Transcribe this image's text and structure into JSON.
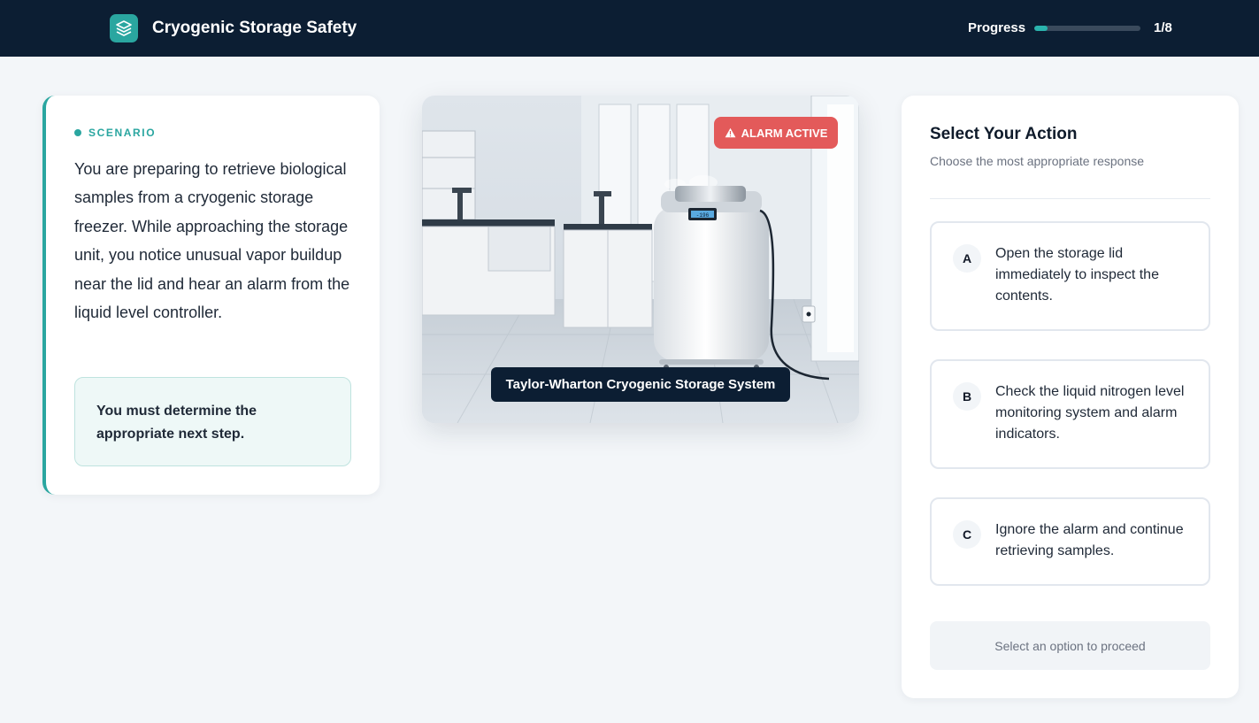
{
  "header": {
    "title": "Cryogenic Storage Safety",
    "progress_label": "Progress",
    "progress_count": "1/8",
    "progress_fraction": 0.125
  },
  "scenario": {
    "tag": "SCENARIO",
    "text": "You are preparing to retrieve biological samples from a cryogenic storage freezer. While approaching the storage unit, you notice unusual vapor buildup near the lid and hear an alarm from the liquid level controller.",
    "note": "You must determine the appropriate next step."
  },
  "scene": {
    "alarm_label": "ALARM ACTIVE",
    "caption": "Taylor-Wharton Cryogenic Storage System",
    "display_reading": "-196"
  },
  "actions": {
    "title": "Select Your Action",
    "subtitle": "Choose the most appropriate response",
    "options": [
      {
        "letter": "A",
        "text": "Open the storage lid immediately to inspect the contents."
      },
      {
        "letter": "B",
        "text": "Check the liquid nitrogen level monitoring system and alarm indicators."
      },
      {
        "letter": "C",
        "text": "Ignore the alarm and continue retrieving samples."
      }
    ],
    "proceed_label": "Select an option to proceed"
  },
  "colors": {
    "header_bg": "#0c1e33",
    "accent": "#2aa6a0",
    "alarm": "#e35a5a"
  }
}
